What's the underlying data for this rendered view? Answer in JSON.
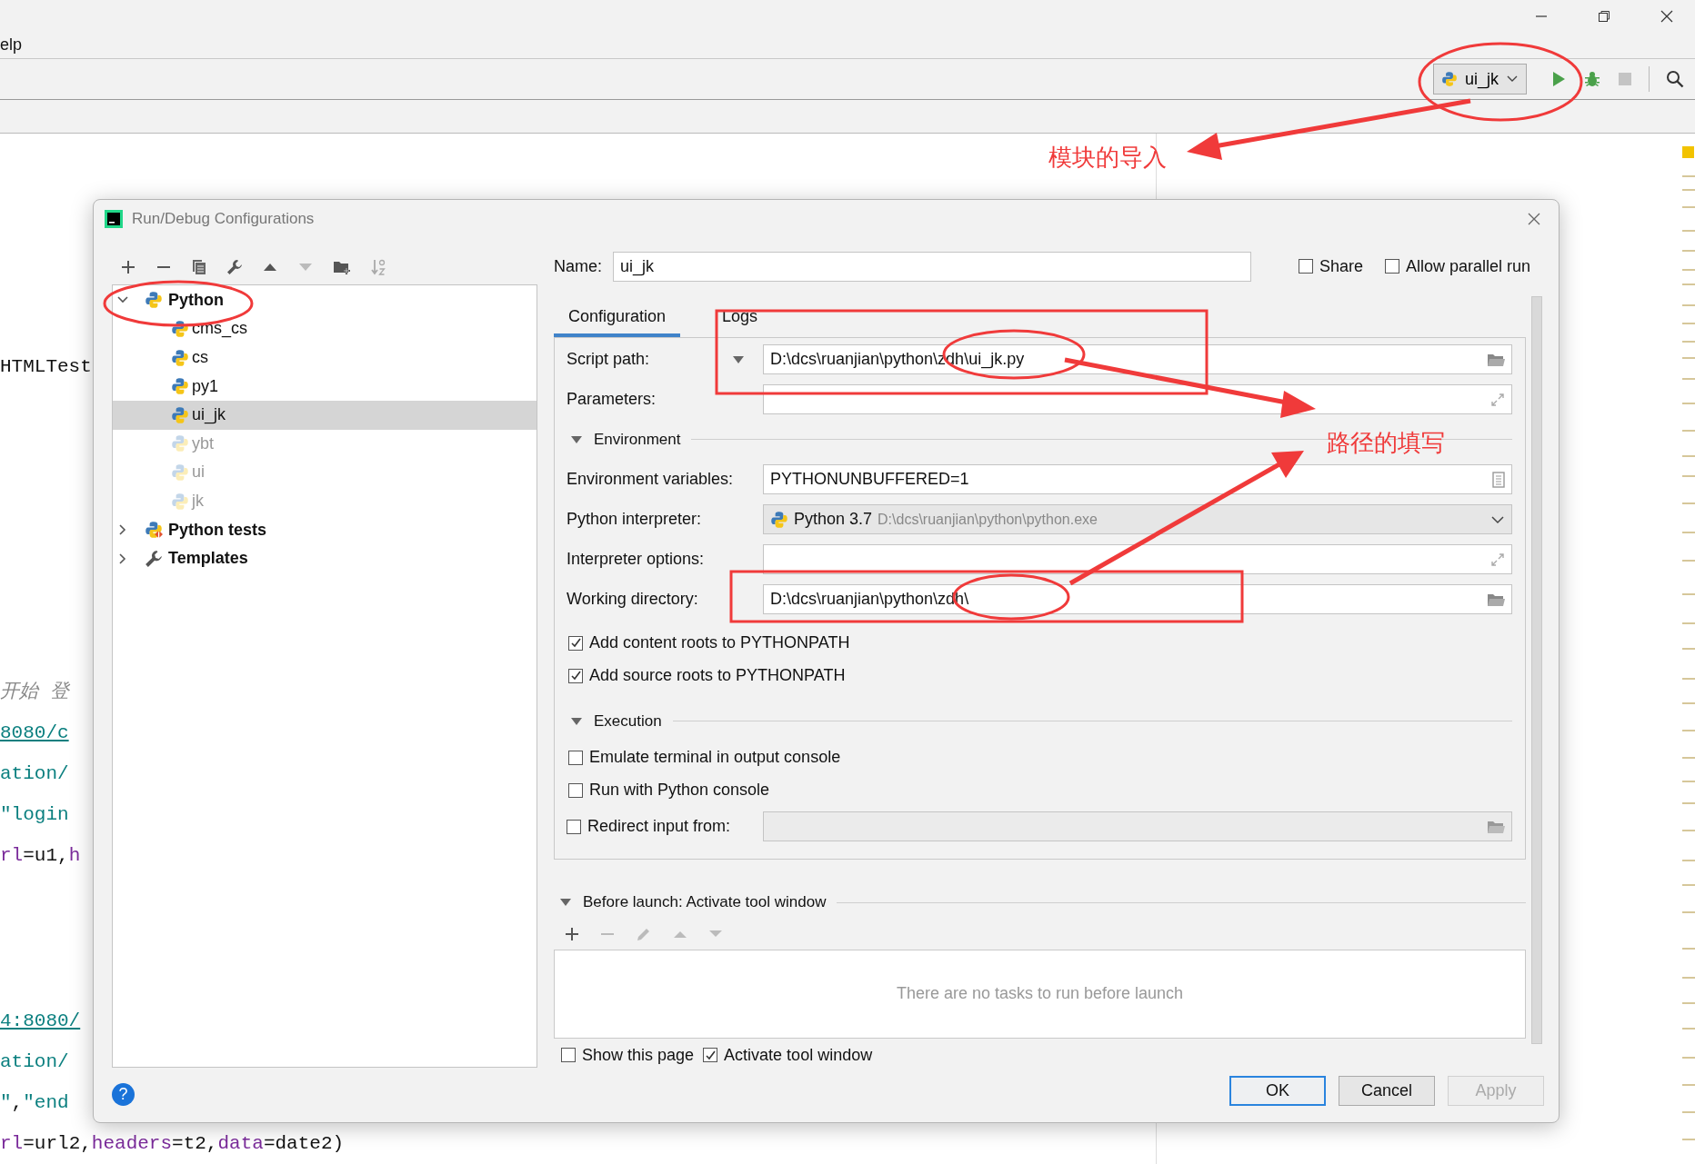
{
  "menu": {
    "items": [
      {
        "label": "elp"
      }
    ]
  },
  "toolbar": {
    "run_config": "ui_jk"
  },
  "editor": {
    "code_blocks": [
      [
        [
          {
            "kind": "plain",
            "text": "HTMLTest"
          }
        ]
      ],
      [
        [
          {
            "kind": "comment",
            "text": "开始 登"
          }
        ],
        [
          {
            "kind": "link",
            "text": "8080/c"
          }
        ],
        [
          {
            "kind": "string",
            "text": "ation/"
          }
        ],
        [
          {
            "kind": "string",
            "text": "″login"
          }
        ],
        [
          {
            "kind": "param",
            "text": "rl"
          },
          {
            "kind": "plain",
            "text": "=u1,"
          },
          {
            "kind": "param",
            "text": "h"
          }
        ]
      ],
      [
        [
          {
            "kind": "link",
            "text": "4:8080/"
          }
        ],
        [
          {
            "kind": "string",
            "text": "ation/"
          }
        ],
        [
          {
            "kind": "string",
            "text": "″"
          },
          {
            "kind": "plain",
            "text": ","
          },
          {
            "kind": "string",
            "text": "″end"
          }
        ],
        [
          {
            "kind": "param",
            "text": "rl"
          },
          {
            "kind": "plain",
            "text": "=url2,"
          },
          {
            "kind": "param",
            "text": "headers"
          },
          {
            "kind": "plain",
            "text": "=t2,"
          },
          {
            "kind": "param",
            "text": "data"
          },
          {
            "kind": "plain",
            "text": "=date2)"
          }
        ]
      ]
    ]
  },
  "annotations": [
    {
      "text": "模块的导入"
    },
    {
      "text": "路径的填写"
    }
  ],
  "dialog": {
    "title": "Run/Debug Configurations",
    "tree": [
      {
        "kind": "python",
        "label": "Python",
        "expanded": true,
        "selected": false,
        "children": [
          {
            "label": "cms_cs",
            "selected": false,
            "disabled": false
          },
          {
            "label": "cs",
            "selected": false,
            "disabled": false
          },
          {
            "label": "py1",
            "selected": false,
            "disabled": false
          },
          {
            "label": "ui_jk",
            "selected": true,
            "disabled": false
          },
          {
            "label": "ybt",
            "selected": false,
            "disabled": true
          },
          {
            "label": "ui",
            "selected": false,
            "disabled": true
          },
          {
            "label": "jk",
            "selected": false,
            "disabled": true
          }
        ]
      },
      {
        "kind": "tests",
        "label": "Python tests",
        "expanded": false,
        "selected": false
      },
      {
        "kind": "templates",
        "label": "Templates",
        "expanded": false,
        "selected": false
      }
    ],
    "name": {
      "label": "Name:",
      "value": "ui_jk"
    },
    "options": [
      {
        "label": "Share",
        "checked": false
      },
      {
        "label": "Allow parallel run",
        "checked": false
      }
    ],
    "tabs": [
      {
        "label": "Configuration",
        "selected": true
      },
      {
        "label": "Logs",
        "selected": false
      }
    ],
    "form": [
      {
        "kind": "script",
        "label": "Script path:",
        "value": "D:\\dcs\\ruanjian\\python\\zdh\\ui_jk.py"
      },
      {
        "kind": "expandable",
        "label": "Parameters:"
      },
      {
        "kind": "section",
        "label": "Environment",
        "expanded": true
      },
      {
        "kind": "env",
        "label": "Environment variables:",
        "value": "PYTHONUNBUFFERED=1"
      },
      {
        "kind": "combo",
        "label": "Python interpreter:",
        "value": "Python 3.7",
        "detail": "D:\\dcs\\ruanjian\\python\\python.exe"
      },
      {
        "kind": "expandable",
        "label": "Interpreter options:"
      },
      {
        "kind": "path",
        "label": "Working directory:",
        "value": "D:\\dcs\\ruanjian\\python\\zdh\\"
      },
      {
        "kind": "check",
        "label": "Add content roots to PYTHONPATH",
        "checked": true
      },
      {
        "kind": "check",
        "label": "Add source roots to PYTHONPATH",
        "checked": true
      },
      {
        "kind": "section",
        "label": "Execution",
        "expanded": true
      },
      {
        "kind": "check",
        "label": "Emulate terminal in output console",
        "checked": false
      },
      {
        "kind": "check",
        "label": "Run with Python console",
        "checked": false
      },
      {
        "kind": "check_field",
        "label": "Redirect input from:",
        "checked": false
      }
    ],
    "before_launch": {
      "label": "Before launch: Activate tool window",
      "expanded": true,
      "empty_text": "There are no tasks to run before launch",
      "options": [
        {
          "label": "Show this page",
          "checked": false
        },
        {
          "label": "Activate tool window",
          "checked": true
        }
      ]
    },
    "help": "?",
    "buttons": [
      {
        "label": "OK",
        "default": true,
        "disabled": false
      },
      {
        "label": "Cancel",
        "default": false,
        "disabled": false
      },
      {
        "label": "Apply",
        "default": false,
        "disabled": true
      }
    ]
  }
}
